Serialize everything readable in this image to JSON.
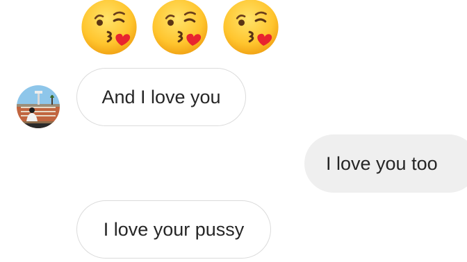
{
  "thread": {
    "emoji_row": {
      "count": 3,
      "icon": "face-blowing-a-kiss-icon",
      "colors": {
        "face": "#ffcc33",
        "heart": "#e8242f"
      }
    },
    "messages": [
      {
        "sender": "other",
        "text": "And I love you"
      },
      {
        "sender": "me",
        "text": "I love you too"
      },
      {
        "sender": "other",
        "text": "I love your pussy"
      }
    ],
    "avatar": {
      "icon": "profile-avatar"
    }
  },
  "colors": {
    "received_bubble_border": "#dbdbdb",
    "sent_bubble_fill": "#efefef",
    "text": "#262626"
  }
}
